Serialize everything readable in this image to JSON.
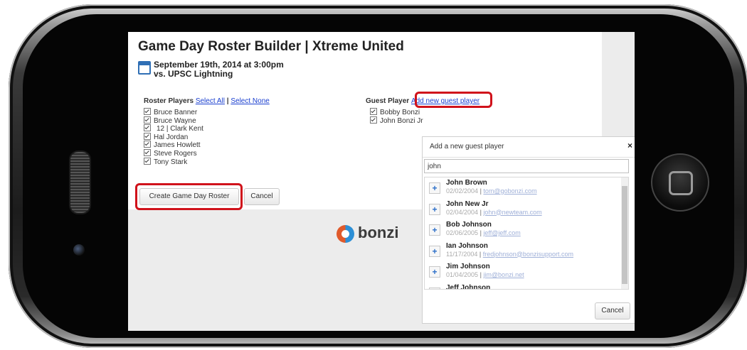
{
  "page": {
    "title": "Game Day Roster Builder | Xtreme United",
    "date": "September 19th, 2014 at 3:00pm",
    "opponent": "vs. UPSC Lightning"
  },
  "roster": {
    "heading": "Roster Players",
    "select_all": "Select All",
    "divider": "|",
    "select_none": "Select None",
    "players": [
      "Bruce Banner",
      "Bruce Wayne",
      "12 | Clark Kent",
      "Hal Jordan",
      "James Howlett",
      "Steve Rogers",
      "Tony Stark"
    ]
  },
  "guest": {
    "heading": "Guest Player",
    "add_link": "Add new guest player",
    "players": [
      "Bobby Bonzi",
      "John Bonzi Jr"
    ]
  },
  "actions": {
    "create": "Create Game Day Roster",
    "cancel": "Cancel"
  },
  "brand": {
    "name": "bonzi"
  },
  "dialog": {
    "title": "Add a new guest player",
    "close": "×",
    "search_value": "john",
    "add_symbol": "+",
    "cancel": "Cancel",
    "results": [
      {
        "name": "John Brown",
        "dob": "02/02/2004",
        "email": "tom@gobonzi.com"
      },
      {
        "name": "John New Jr",
        "dob": "02/04/2004",
        "email": "john@newteam.com"
      },
      {
        "name": "Bob Johnson",
        "dob": "02/06/2005",
        "email": "jeff@jeff.com"
      },
      {
        "name": "Ian Johnson",
        "dob": "11/17/2004",
        "email": "fredjohnson@bonzisupport.com"
      },
      {
        "name": "Jim Johnson",
        "dob": "01/04/2005",
        "email": "jim@bonzi.net"
      },
      {
        "name": "Jeff Johnson",
        "dob": "",
        "email": ""
      }
    ]
  },
  "colors": {
    "highlight": "#d0121b",
    "link": "#1a3fcf",
    "accent": "#2f6fb5"
  }
}
